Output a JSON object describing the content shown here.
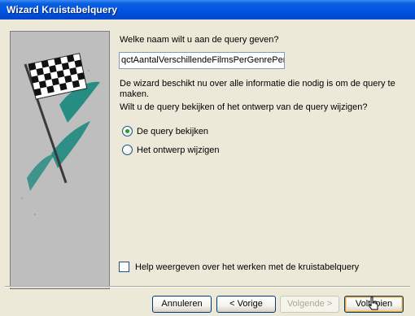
{
  "window": {
    "title": "Wizard Kruistabelquery"
  },
  "question": {
    "label": "Welke naam wilt u aan de query geven?"
  },
  "query_name": {
    "value": "qctAantalVerschillendeFilmsPerGenrePerLev"
  },
  "info": {
    "line1": "De wizard beschikt nu over alle informatie die nodig is om de query te maken.",
    "line2": "Wilt u de query bekijken of het ontwerp van de query wijzigen?"
  },
  "options": {
    "view": {
      "label": "De query bekijken",
      "selected": true
    },
    "modify": {
      "label": "Het ontwerp wijzigen",
      "selected": false
    }
  },
  "help": {
    "label": "Help weergeven over het werken met de kruistabelquery",
    "checked": false
  },
  "buttons": {
    "cancel": "Annuleren",
    "back": "< Vorige",
    "next": "Volgende >",
    "finish": "Voltooien"
  },
  "colors": {
    "titlebar": "#0054e3",
    "panel": "#bebebe",
    "accent_brush": "#1f8a80",
    "radio_dot": "#21a121"
  }
}
